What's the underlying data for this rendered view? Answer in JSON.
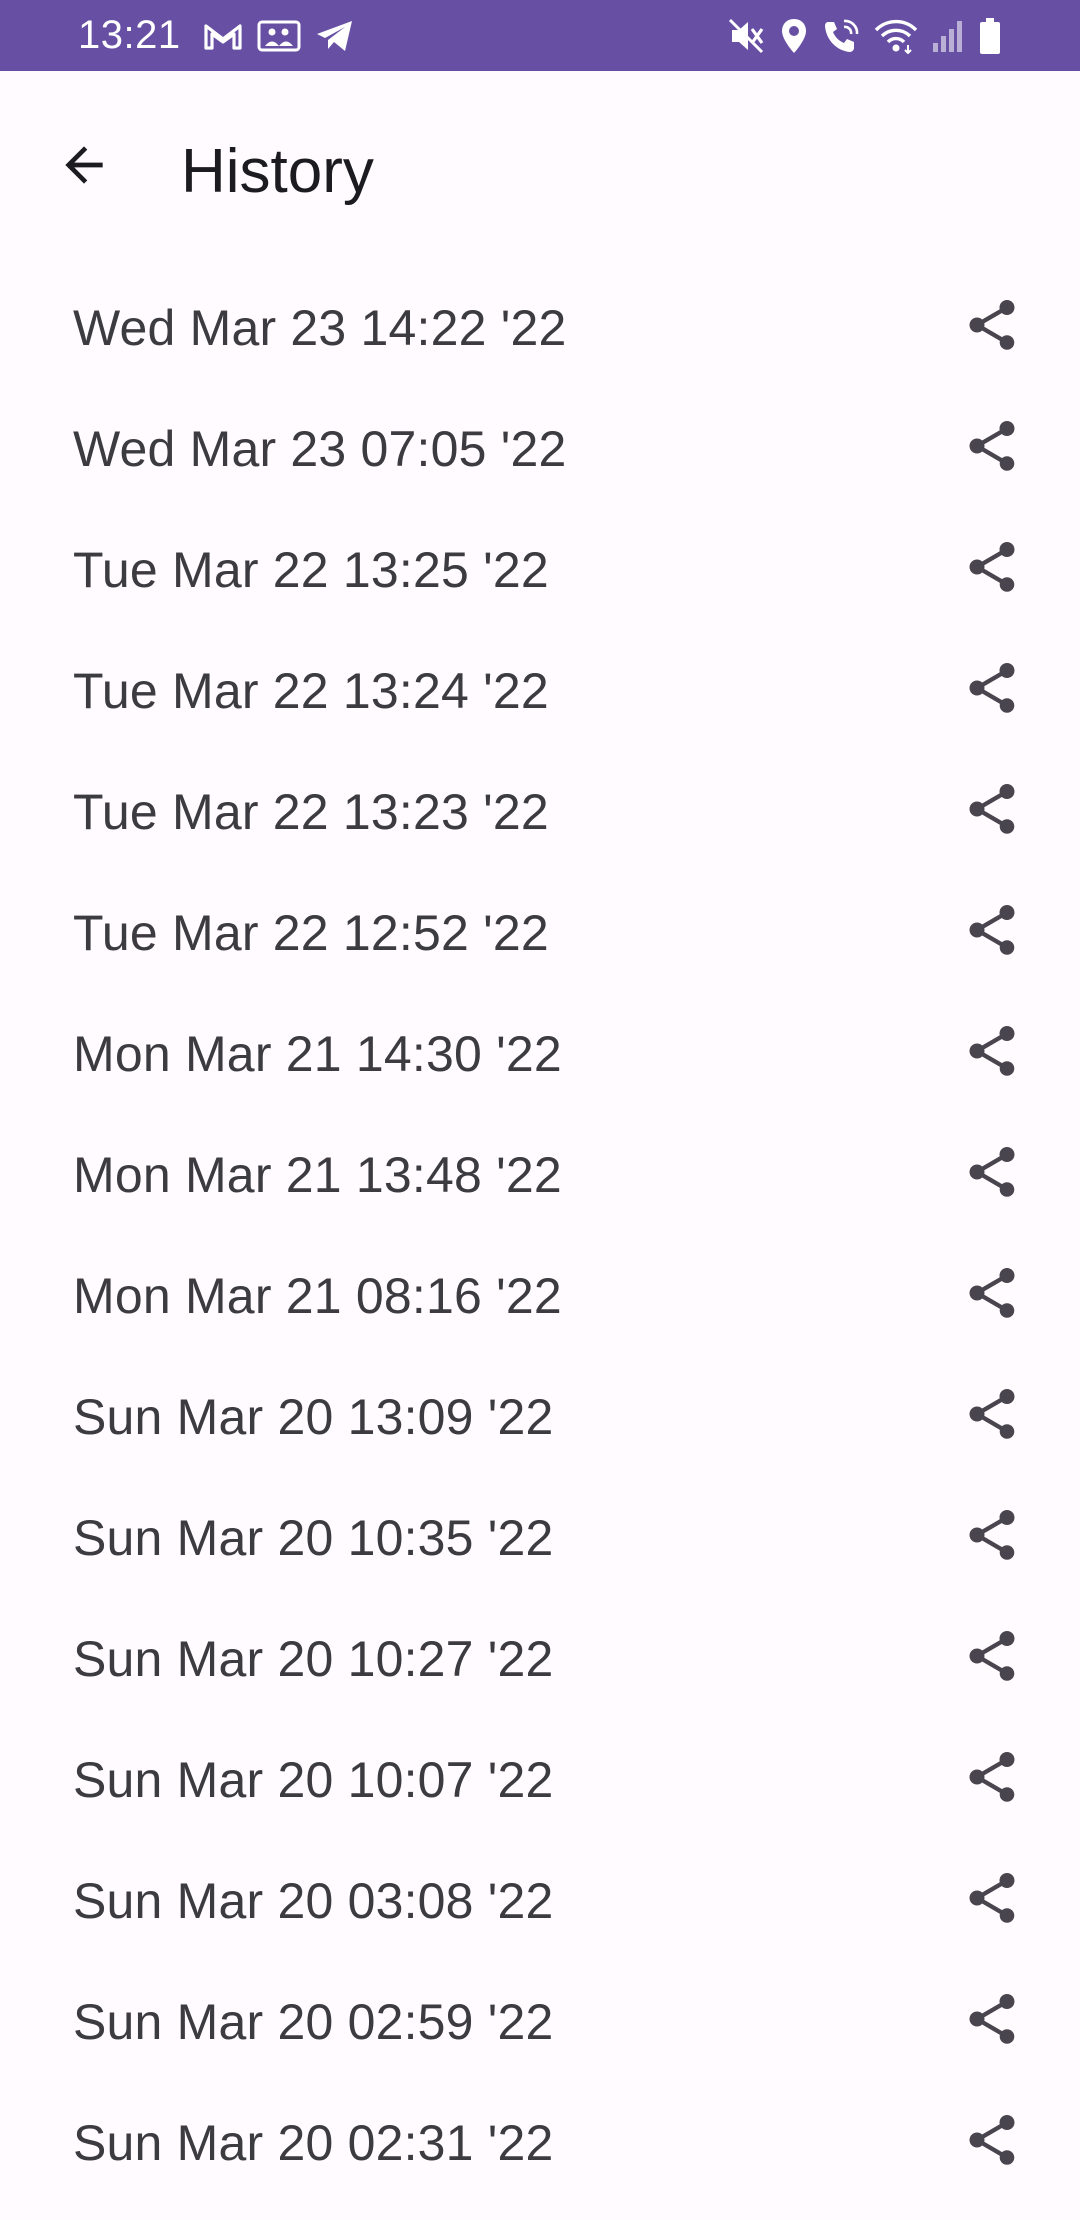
{
  "status_bar": {
    "time": "13:21",
    "left_icons": [
      "gmail-icon",
      "gallery-icon",
      "telegram-icon"
    ],
    "right_icons": [
      "mute-icon",
      "location-icon",
      "wifi-calling-icon",
      "wifi-icon",
      "signal-icon",
      "battery-icon"
    ]
  },
  "app_bar": {
    "title": "History",
    "back_icon": "arrow-back-icon"
  },
  "history": {
    "items": [
      {
        "label": "Wed Mar 23 14:22 '22"
      },
      {
        "label": "Wed Mar 23 07:05 '22"
      },
      {
        "label": "Tue Mar 22 13:25 '22"
      },
      {
        "label": "Tue Mar 22 13:24 '22"
      },
      {
        "label": "Tue Mar 22 13:23 '22"
      },
      {
        "label": "Tue Mar 22 12:52 '22"
      },
      {
        "label": "Mon Mar 21 14:30 '22"
      },
      {
        "label": "Mon Mar 21 13:48 '22"
      },
      {
        "label": "Mon Mar 21 08:16 '22"
      },
      {
        "label": "Sun Mar 20 13:09 '22"
      },
      {
        "label": "Sun Mar 20 10:35 '22"
      },
      {
        "label": "Sun Mar 20 10:27 '22"
      },
      {
        "label": "Sun Mar 20 10:07 '22"
      },
      {
        "label": "Sun Mar 20 03:08 '22"
      },
      {
        "label": "Sun Mar 20 02:59 '22"
      },
      {
        "label": "Sun Mar 20 02:31 '22"
      }
    ],
    "row_icon": "share-icon"
  },
  "colors": {
    "status_bar": "#6750a4",
    "background": "#fffbfe",
    "text": "#3c3b40",
    "icon": "#49454f"
  }
}
